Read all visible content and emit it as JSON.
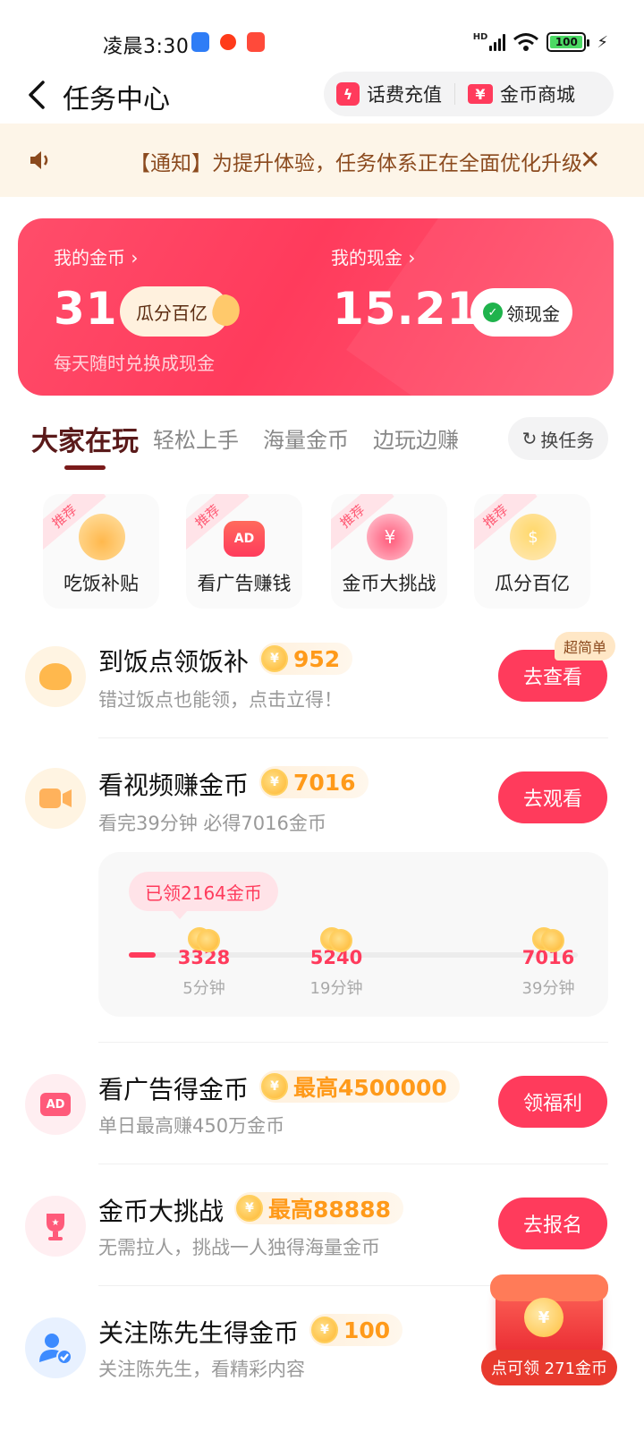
{
  "status_bar": {
    "time": "凌晨3:30",
    "network": "HD",
    "battery": "100"
  },
  "header": {
    "title": "任务中心",
    "recharge_label": "话费充值",
    "mall_label": "金币商城"
  },
  "notice": {
    "text": "【通知】为提升体验，任务体系正在全面优化升级"
  },
  "wallet": {
    "coins_label": "我的金币",
    "coins_value": "31",
    "coins_tag": "瓜分百亿",
    "coins_sub": "每天随时兑换成现金",
    "cash_label": "我的现金",
    "cash_value": "15.21",
    "cash_button": "领现金"
  },
  "tabs": {
    "items": [
      "大家在玩",
      "轻松上手",
      "海量金币",
      "边玩边赚"
    ],
    "active": 0,
    "swap_label": "换任务"
  },
  "features": [
    {
      "label": "吃饭补贴",
      "tag": "推荐",
      "icon": "noodle-bowl-icon"
    },
    {
      "label": "看广告赚钱",
      "tag": "推荐",
      "icon": "ad-tv-icon"
    },
    {
      "label": "金币大挑战",
      "tag": "推荐",
      "icon": "money-bag-icon"
    },
    {
      "label": "瓜分百亿",
      "tag": "推荐",
      "icon": "hand-coin-icon"
    }
  ],
  "tasks": [
    {
      "title": "到饭点领饭补",
      "reward": "952",
      "desc": "错过饭点也能领，点击立得！",
      "button": "去查看",
      "badge": "超简单",
      "icon": "meal-icon",
      "icon_color": "#ffb84d"
    },
    {
      "title": "看视频赚金币",
      "reward": "7016",
      "desc": "看完39分钟 必得7016金币",
      "button": "去观看",
      "icon": "video-icon",
      "icon_color": "#ffb25c"
    },
    {
      "title": "看广告得金币",
      "reward": "最高4500000",
      "desc": "单日最高赚450万金币",
      "button": "领福利",
      "icon": "ad-icon",
      "icon_color": "#ff5a7a"
    },
    {
      "title": "金币大挑战",
      "reward": "最高88888",
      "desc": "无需拉人，挑战一人独得海量金币",
      "button": "去报名",
      "icon": "trophy-icon",
      "icon_color": "#ff5a7a"
    },
    {
      "title": "关注陈先生得金币",
      "reward": "100",
      "desc": "关注陈先生，看精彩内容",
      "icon": "follow-user-icon",
      "icon_color": "#3d8bff"
    }
  ],
  "video_progress": {
    "claimed_text": "已领2164金币",
    "progress": 0.06,
    "milestones": [
      {
        "coins": "3328",
        "time": "5分钟"
      },
      {
        "coins": "5240",
        "time": "19分钟"
      },
      {
        "coins": "7016",
        "time": "39分钟"
      }
    ]
  },
  "float_gift": {
    "label": "点可领 271金币"
  },
  "colors": {
    "accent": "#ff3b5c",
    "gold": "#ff9a1a",
    "notice_bg": "#fdf5e8"
  }
}
